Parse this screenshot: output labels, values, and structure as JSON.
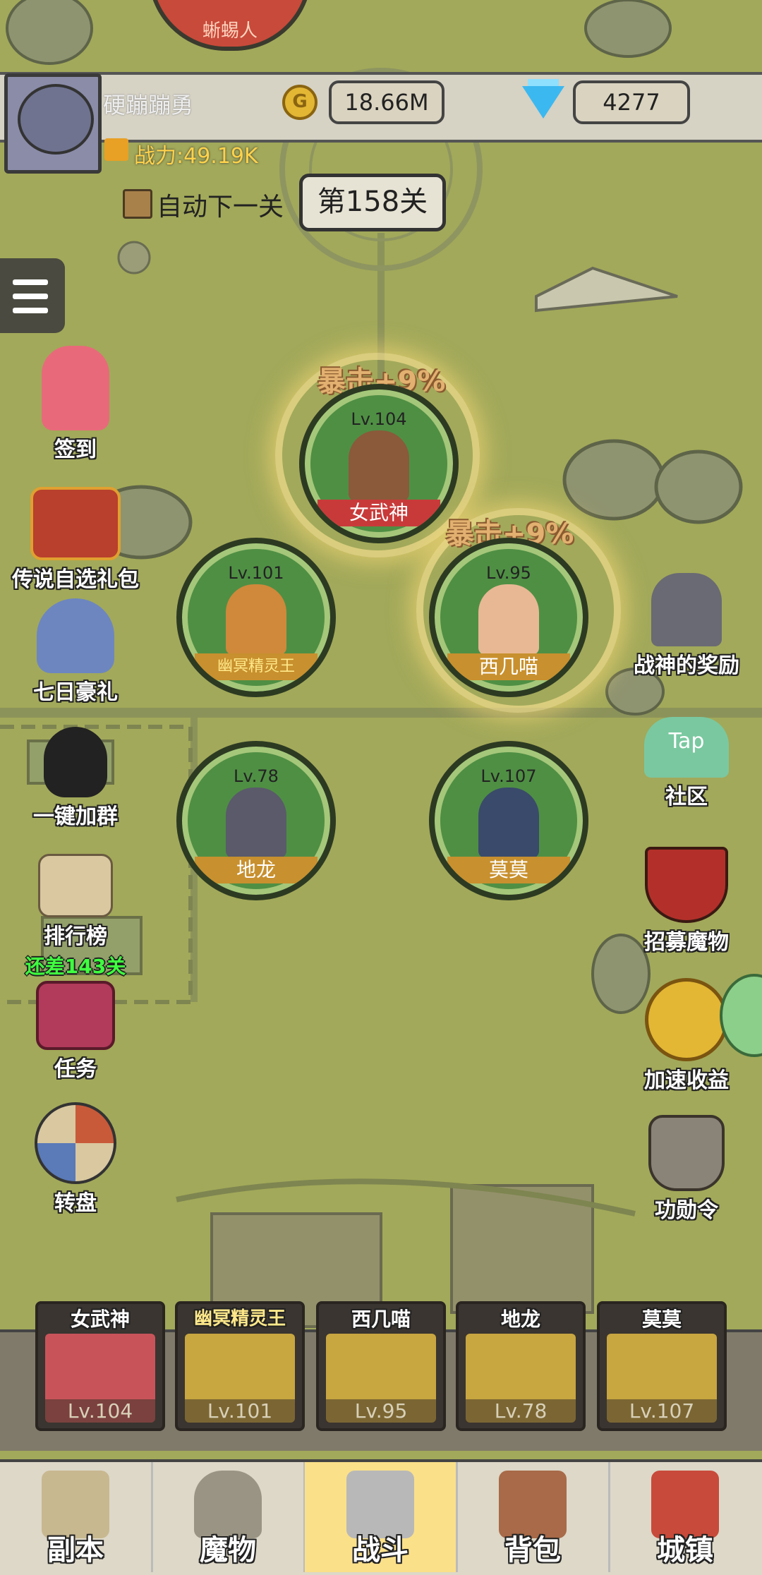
{
  "top_enemy": {
    "name": "蜥蜴人"
  },
  "header": {
    "player_name": "硬蹦蹦勇",
    "gold": "18.66M",
    "diamonds": "4277",
    "power": "战力:49.19K"
  },
  "stage": {
    "auto_next_label": "自动下一关",
    "current": "第158关"
  },
  "left_menu": [
    {
      "label": "签到"
    },
    {
      "label": "传说自选礼包"
    },
    {
      "label": "七日豪礼"
    },
    {
      "label": "一键加群"
    },
    {
      "label": "排行榜",
      "sub": "还差143关"
    },
    {
      "label": "任务"
    },
    {
      "label": "转盘"
    }
  ],
  "right_menu": [
    {
      "label": "战神的奖励"
    },
    {
      "label": "社区",
      "badge": "Tap"
    },
    {
      "label": "招募魔物"
    },
    {
      "label": "加速收益"
    },
    {
      "label": "功勋令"
    }
  ],
  "crit_bonus": "暴击+9%",
  "heroes": [
    {
      "name": "女武神",
      "level": "Lv.104"
    },
    {
      "name": "幽冥精灵王",
      "level": "Lv.101"
    },
    {
      "name": "西几喵",
      "level": "Lv.95"
    },
    {
      "name": "地龙",
      "level": "Lv.78"
    },
    {
      "name": "莫莫",
      "level": "Lv.107"
    }
  ],
  "team": [
    {
      "name": "女武神",
      "level": "Lv.104"
    },
    {
      "name": "幽冥精灵王",
      "level": "Lv.101"
    },
    {
      "name": "西几喵",
      "level": "Lv.95"
    },
    {
      "name": "地龙",
      "level": "Lv.78"
    },
    {
      "name": "莫莫",
      "level": "Lv.107"
    }
  ],
  "nav": [
    {
      "label": "副本"
    },
    {
      "label": "魔物"
    },
    {
      "label": "战斗"
    },
    {
      "label": "背包"
    },
    {
      "label": "城镇"
    }
  ],
  "colors": {
    "map_bg": "#a2a95a",
    "hero_circle": "#4f8f44",
    "active_tab": "#fbe08a",
    "legend_name": "#ffe98a"
  }
}
